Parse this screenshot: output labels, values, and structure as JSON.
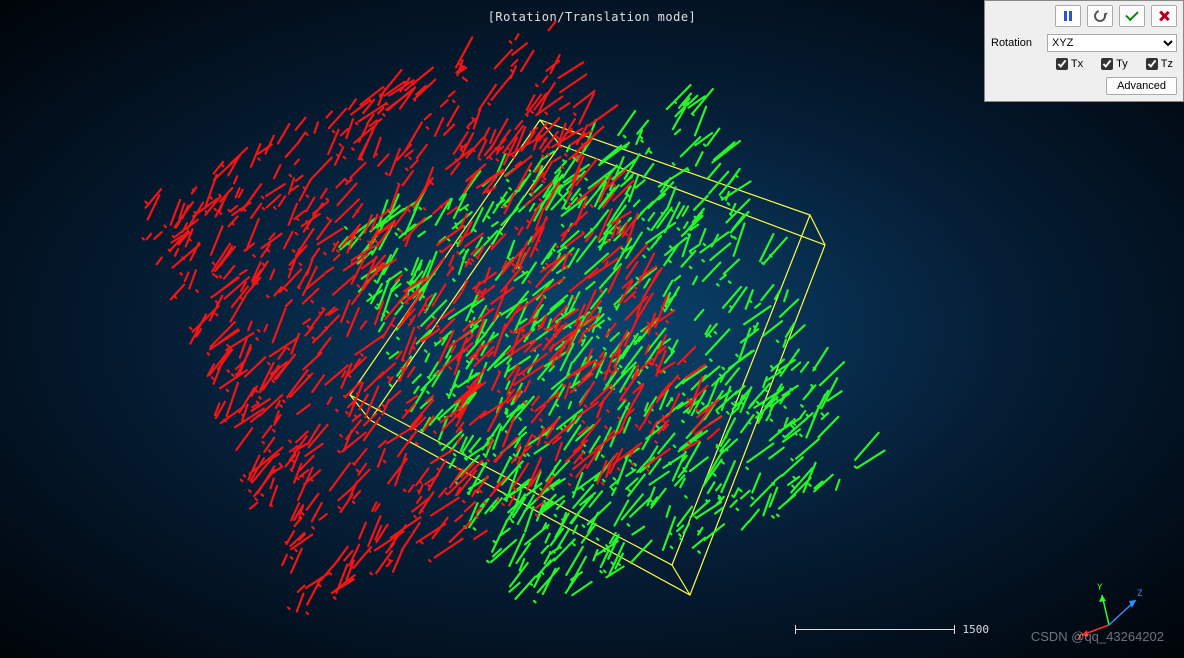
{
  "mode_label": "[Rotation/Translation mode]",
  "panel": {
    "rotation_label": "Rotation",
    "rotation_value": "XYZ",
    "tx_label": "Tx",
    "ty_label": "Ty",
    "tz_label": "Tz",
    "tx_checked": true,
    "ty_checked": true,
    "tz_checked": true,
    "advanced_label": "Advanced",
    "buttons": {
      "pause": "pause",
      "reset": "reset",
      "confirm": "confirm",
      "cancel": "cancel"
    }
  },
  "scalebar": {
    "value": "1500"
  },
  "axis": {
    "x": "X",
    "y": "Y",
    "z": "Z",
    "colors": {
      "x": "#ff3030",
      "y": "#30ff30",
      "z": "#3090ff"
    }
  },
  "watermark": "CSDN @qq_43264202",
  "pointclouds": {
    "red_color": "#ff1515",
    "green_color": "#2aff2a",
    "bbox_color": "#ffff40"
  }
}
